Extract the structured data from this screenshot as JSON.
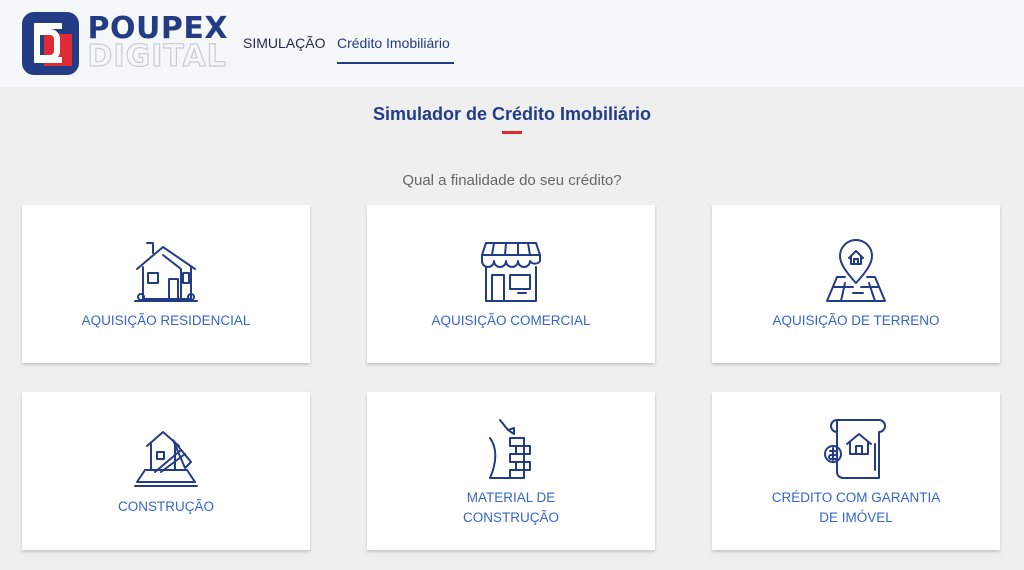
{
  "header": {
    "logo_line1": "POUPEX",
    "logo_line2": "DIGITAL",
    "nav": [
      {
        "label": "SIMULAÇÃO"
      },
      {
        "label": "Crédito Imobiliário"
      }
    ]
  },
  "main": {
    "title": "Simulador de Crédito Imobiliário",
    "question": "Qual a finalidade do seu crédito?",
    "options": [
      {
        "line1": "AQUISIÇÃO RESIDENCIAL",
        "line2": "",
        "icon": "house-icon"
      },
      {
        "line1": "AQUISIÇÃO COMERCIAL",
        "line2": "",
        "icon": "storefront-icon"
      },
      {
        "line1": "AQUISIÇÃO DE TERRENO",
        "line2": "",
        "icon": "map-pin-house-icon"
      },
      {
        "line1": "CONSTRUÇÃO",
        "line2": "",
        "icon": "construction-blueprint-icon"
      },
      {
        "line1": "MATERIAL DE",
        "line2": "CONSTRUÇÃO",
        "icon": "brick-wall-icon"
      },
      {
        "line1": "CRÉDITO COM GARANTIA",
        "line2": "DE IMÓVEL",
        "icon": "property-document-money-icon"
      }
    ]
  },
  "colors": {
    "brand_blue": "#233c86",
    "accent_red": "#e02a34",
    "link_blue": "#3366cc"
  }
}
